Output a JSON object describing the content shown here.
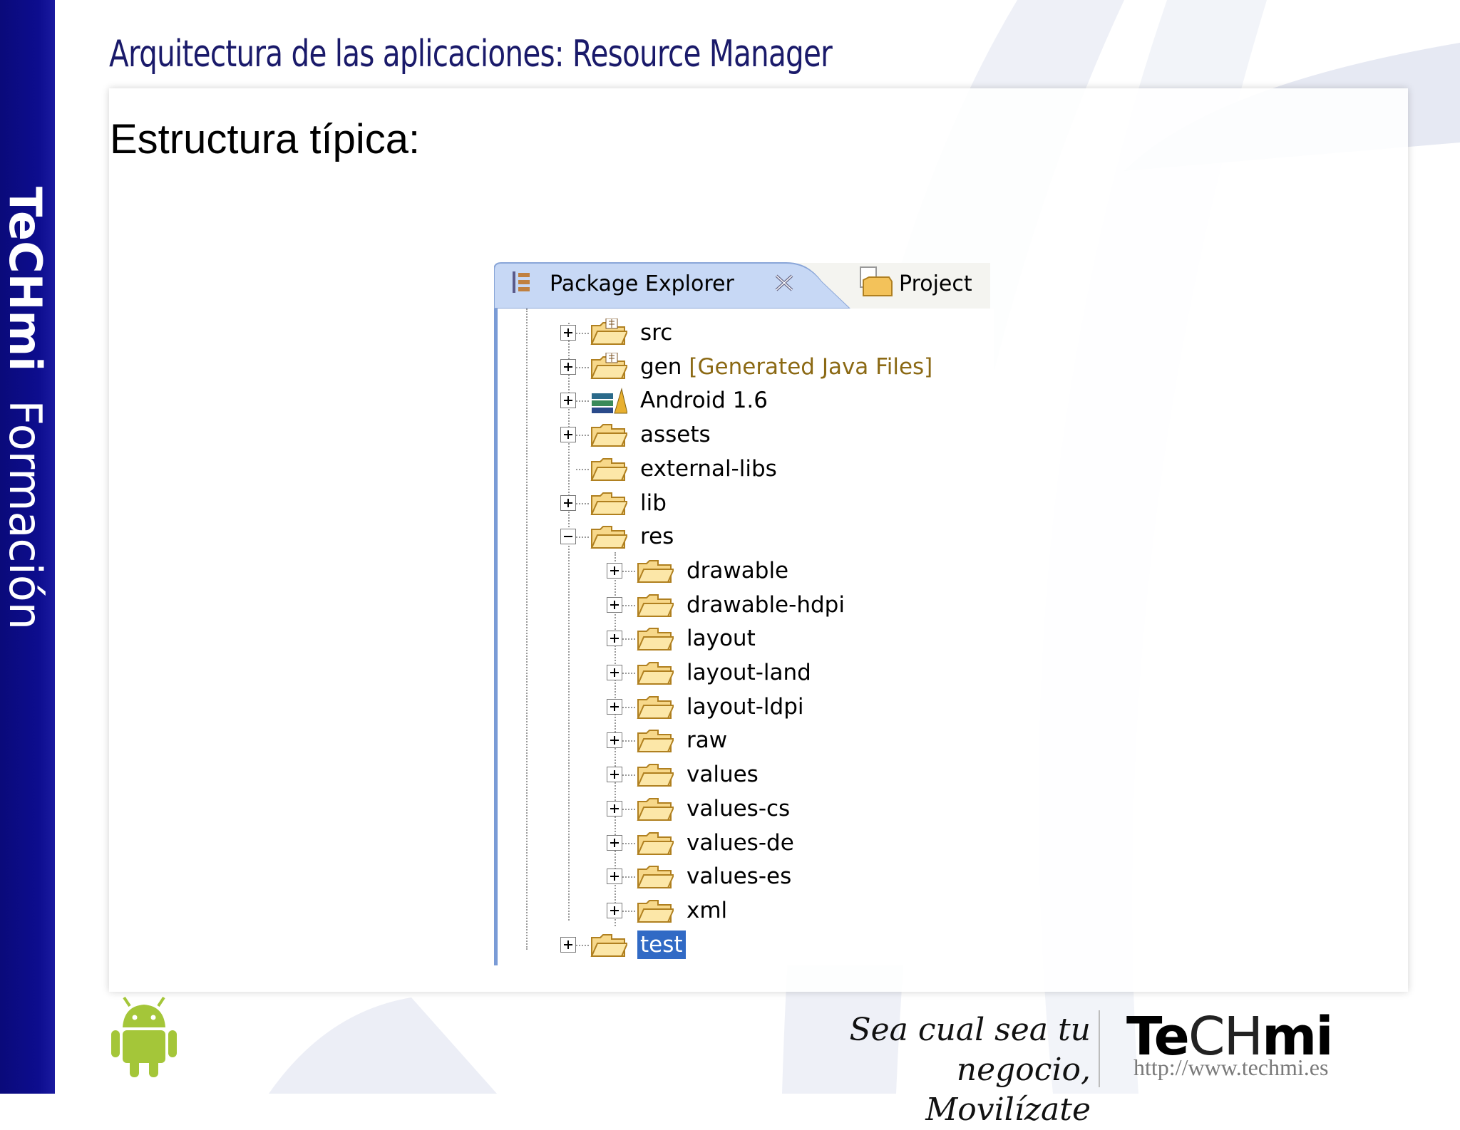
{
  "sidebar": {
    "brand": "TeCHmi",
    "tagline": "Formación"
  },
  "slide": {
    "title": "Arquitectura de las aplicaciones: Resource Manager",
    "subtitle": "Estructura típica:"
  },
  "explorer": {
    "tabs": [
      {
        "label": "Package Explorer",
        "icon": "package-explorer-icon",
        "active": true,
        "closable": true
      },
      {
        "label": "Project",
        "icon": "project-icon",
        "active": false
      }
    ],
    "tree": [
      {
        "label": "src",
        "icon": "source-folder-icon",
        "expander": "plus",
        "level": 0
      },
      {
        "label": "gen",
        "decoration": "[Generated Java Files]",
        "icon": "source-folder-icon",
        "expander": "plus",
        "level": 0
      },
      {
        "label": "Android 1.6",
        "icon": "library-icon",
        "expander": "plus",
        "level": 0
      },
      {
        "label": "assets",
        "icon": "folder-icon",
        "expander": "plus",
        "level": 0
      },
      {
        "label": "external-libs",
        "icon": "folder-icon",
        "expander": "none",
        "level": 0
      },
      {
        "label": "lib",
        "icon": "folder-icon",
        "expander": "plus",
        "level": 0
      },
      {
        "label": "res",
        "icon": "folder-icon",
        "expander": "minus",
        "level": 0
      },
      {
        "label": "drawable",
        "icon": "folder-icon",
        "expander": "plus",
        "level": 1
      },
      {
        "label": "drawable-hdpi",
        "icon": "folder-icon",
        "expander": "plus",
        "level": 1
      },
      {
        "label": "layout",
        "icon": "folder-icon",
        "expander": "plus",
        "level": 1
      },
      {
        "label": "layout-land",
        "icon": "folder-icon",
        "expander": "plus",
        "level": 1
      },
      {
        "label": "layout-ldpi",
        "icon": "folder-icon",
        "expander": "plus",
        "level": 1
      },
      {
        "label": "raw",
        "icon": "folder-icon",
        "expander": "plus",
        "level": 1
      },
      {
        "label": "values",
        "icon": "folder-icon",
        "expander": "plus",
        "level": 1
      },
      {
        "label": "values-cs",
        "icon": "folder-icon",
        "expander": "plus",
        "level": 1
      },
      {
        "label": "values-de",
        "icon": "folder-icon",
        "expander": "plus",
        "level": 1
      },
      {
        "label": "values-es",
        "icon": "folder-icon",
        "expander": "plus",
        "level": 1
      },
      {
        "label": "xml",
        "icon": "folder-icon",
        "expander": "plus",
        "level": 1
      },
      {
        "label": "test",
        "icon": "folder-icon",
        "expander": "plus",
        "level": 0,
        "selected": true
      }
    ]
  },
  "footer": {
    "slogan_line1": "Sea cual sea tu negocio,",
    "slogan_line2": "Movilízate",
    "logo_part1": "Te",
    "logo_part2": "CH",
    "logo_part3": "mi",
    "url": "http://www.techmi.es"
  },
  "colors": {
    "sidebar": "#0d0d8e",
    "title": "#1a1a6a",
    "selection": "#316ac5",
    "tab_active": "#c7d8f5",
    "folder": "#f3c25a"
  }
}
